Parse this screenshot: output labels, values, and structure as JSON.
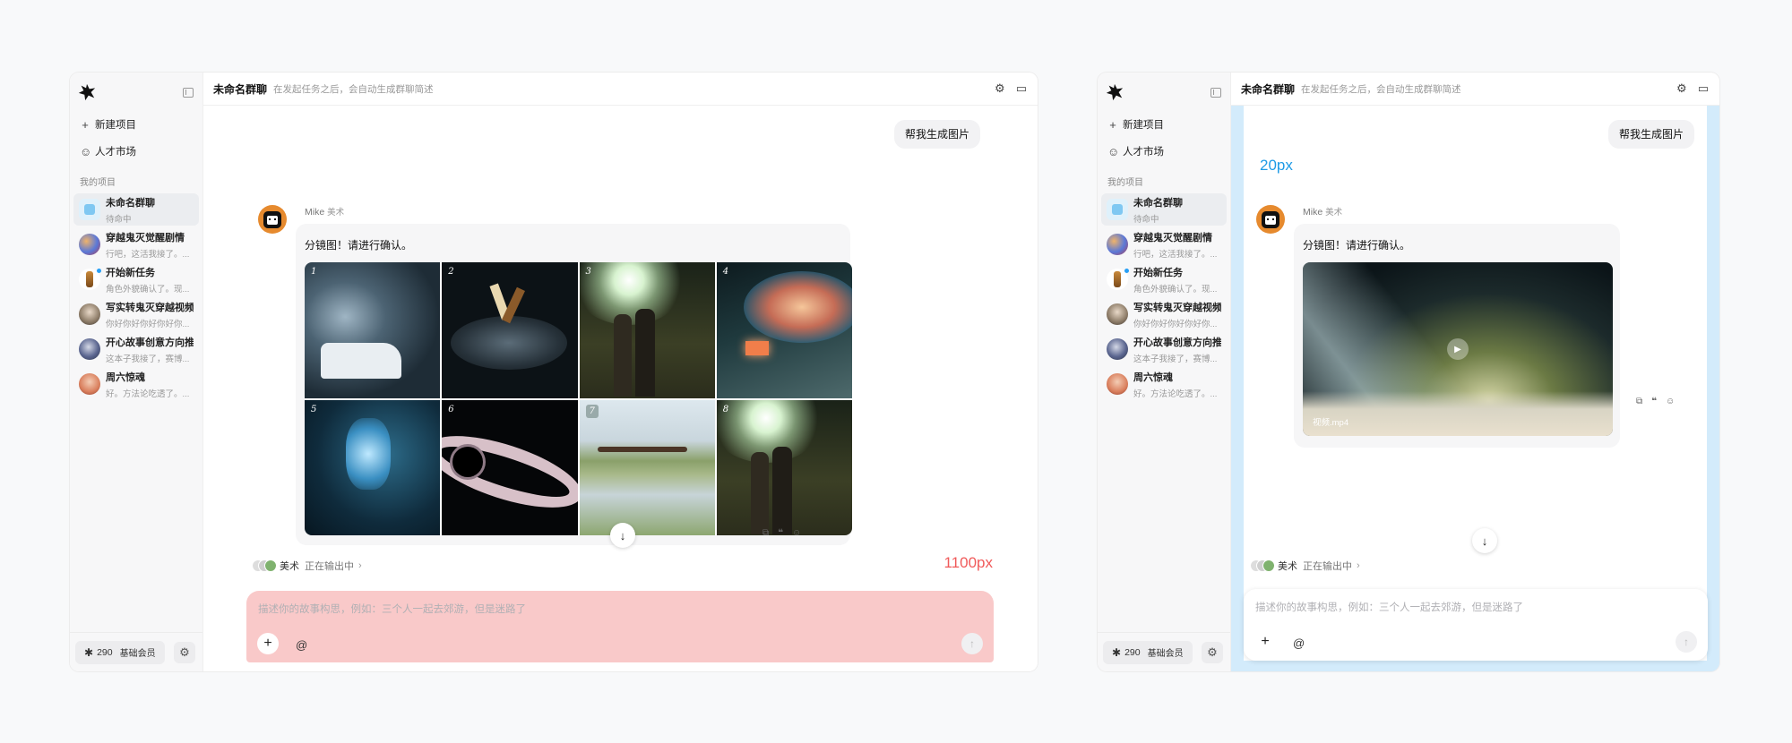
{
  "colors": {
    "accent": "#2aa0f5",
    "measure_red": "#f05a5a",
    "measure_blue": "#1e9be6",
    "overlay_red": "#f9c9c9",
    "overlay_blue": "#d3ebfb"
  },
  "sidebar": {
    "new_project": "新建项目",
    "talent_market": "人才市场",
    "section": "我的项目",
    "projects": [
      {
        "title": "未命名群聊",
        "sub": "待命中",
        "icon": "group-chat-icon"
      },
      {
        "title": "穿越鬼灭觉醒剧情",
        "sub": "行吧，这活我接了。..."
      },
      {
        "title": "开始新任务",
        "sub": "角色外貌确认了。现..."
      },
      {
        "title": "写实转鬼灭穿越视频",
        "sub": "你好你好你好你好你..."
      },
      {
        "title": "开心故事创意方向推荐",
        "sub": "这本子我接了，赛博..."
      },
      {
        "title": "周六惊魂",
        "sub": "好。方法论吃透了。..."
      }
    ],
    "credits_icon": "asterisk-icon",
    "credits": "290",
    "level": "基础会员"
  },
  "header": {
    "title": "未命名群聊",
    "subtitle": "在发起任务之后，会自动生成群聊简述"
  },
  "chat": {
    "user_message": "帮我生成图片",
    "sender_name": "Mike",
    "sender_role": "美术",
    "message_text": "分镜图！请进行确认。",
    "grid_numbers": [
      "1",
      "2",
      "3",
      "4",
      "5",
      "6",
      "7",
      "8"
    ],
    "video_filename": "视频.mp4"
  },
  "status": {
    "role": "美术",
    "text": "正在输出中"
  },
  "composer": {
    "placeholder": "描述你的故事构思，例如：三个人一起去郊游，但是迷路了",
    "at": "@"
  },
  "annotations": {
    "width_label": "1100px",
    "gap_label": "20px"
  }
}
